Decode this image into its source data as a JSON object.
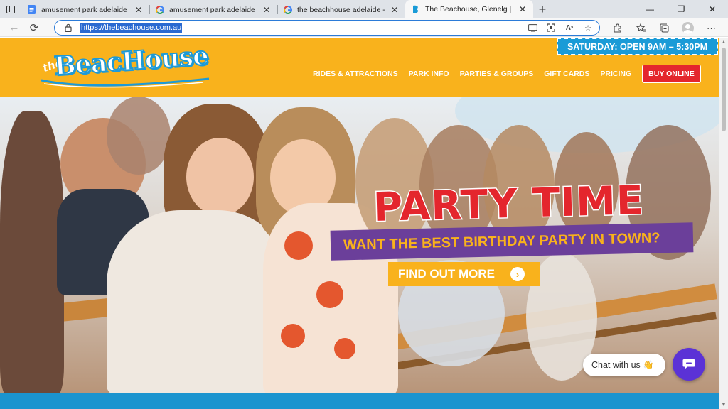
{
  "browser": {
    "tabs": [
      {
        "title": "amusement park adelaide - Goog",
        "favicon": "docs-icon",
        "active": false
      },
      {
        "title": "amusement park adelaide - Goog",
        "favicon": "google-icon",
        "active": false
      },
      {
        "title": "the beachhouse adelaide - Goog",
        "favicon": "google-icon",
        "active": false
      },
      {
        "title": "The Beachouse, Glenelg | Family",
        "favicon": "beachouse-icon",
        "active": true
      }
    ],
    "new_tab_symbol": "+",
    "close_symbol": "✕",
    "url": "https://thebeachouse.com.au"
  },
  "site": {
    "logo_small": "the",
    "logo_word": "BeacHouse",
    "open_badge": "SATURDAY: OPEN 9AM – 5:30PM",
    "nav": [
      "RIDES & ATTRACTIONS",
      "PARK INFO",
      "PARTIES & GROUPS",
      "GIFT CARDS",
      "PRICING"
    ],
    "buy_button": "BUY ONLINE"
  },
  "hero": {
    "title": "PARTY TIME",
    "subtitle": "WANT THE BEST BIRTHDAY PARTY IN TOWN?",
    "cta_label": "FIND OUT MORE",
    "cta_arrow": "›"
  },
  "chat": {
    "label": "Chat with us",
    "emoji": "👋"
  },
  "colors": {
    "header": "#f9b21c",
    "accent_blue": "#1a9bd7",
    "party_red": "#e4262d",
    "banner_purple": "#6b3f9a",
    "chat_purple": "#5b32d6"
  }
}
